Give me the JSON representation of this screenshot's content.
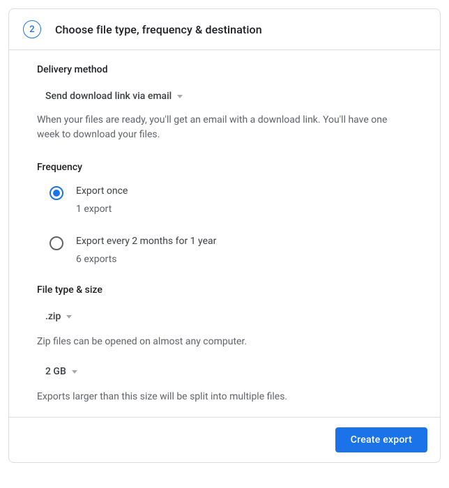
{
  "step": {
    "number": "2",
    "title": "Choose file type, frequency & destination"
  },
  "delivery": {
    "label": "Delivery method",
    "selected": "Send download link via email",
    "help": "When your files are ready, you'll get an email with a download link. You'll have one week to download your files."
  },
  "frequency": {
    "label": "Frequency",
    "options": [
      {
        "title": "Export once",
        "sub": "1 export",
        "selected": true
      },
      {
        "title": "Export every 2 months for 1 year",
        "sub": "6 exports",
        "selected": false
      }
    ]
  },
  "filetype": {
    "label": "File type & size",
    "type_selected": ".zip",
    "type_help": "Zip files can be opened on almost any computer.",
    "size_selected": "2 GB",
    "size_help": "Exports larger than this size will be split into multiple files."
  },
  "footer": {
    "create_label": "Create export"
  }
}
